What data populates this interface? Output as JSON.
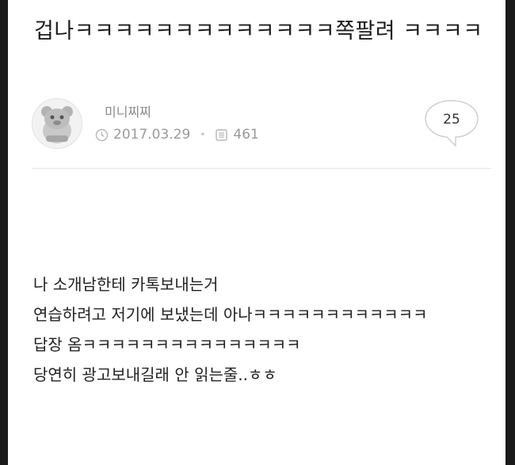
{
  "post": {
    "title": "겁나ㅋㅋㅋㅋㅋㅋㅋㅋㅋㅋㅋㅋㅋ쪽팔려 ㅋㅋㅋㅋ",
    "author": "미니찌찌",
    "date": "2017.03.29",
    "views": "461",
    "comment_count": "25",
    "body_lines": [
      "나 소개남한테 카톡보내는거",
      "연습하려고 저기에 보냈는데 아나ㅋㅋㅋㅋㅋㅋㅋㅋㅋㅋㅋㅋ",
      "답장 옴ㅋㅋㅋㅋㅋㅋㅋㅋㅋㅋㅋㅋㅋㅋㅋ",
      "당연히 광고보내길래 안 읽는줄..ㅎㅎ"
    ]
  },
  "icons": {
    "date": "clock-icon",
    "views": "views-icon",
    "comment": "speech-bubble-icon",
    "avatar": "bear-avatar-icon"
  }
}
